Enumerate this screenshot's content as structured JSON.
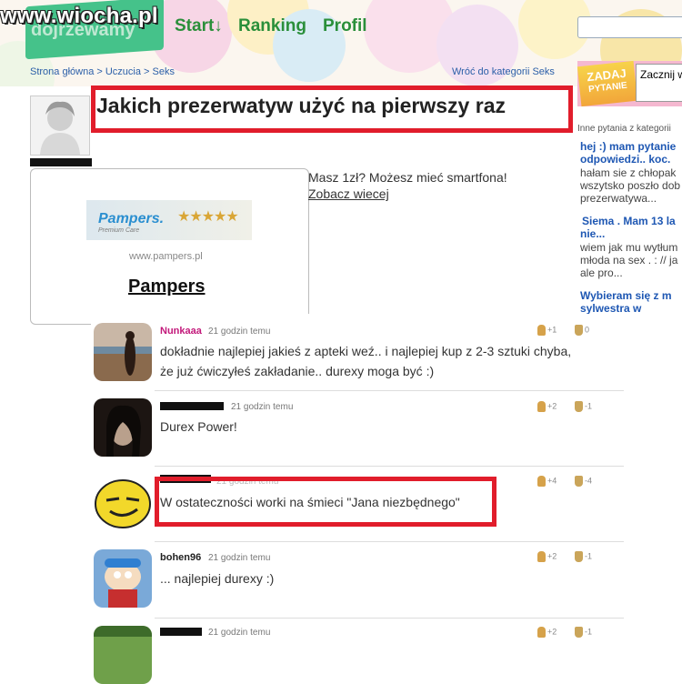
{
  "header": {
    "watermark": "www.wiocha.pl",
    "site_name": "dojrzewamy",
    "nav": [
      "Start↓",
      "Ranking",
      "Profil"
    ],
    "search_placeholder": ""
  },
  "breadcrumb": "Strona główna > Uczucia > Seks",
  "back_link": "Wróć do kategorii Seks",
  "ask": {
    "badge_line1": "ZADAJ",
    "badge_line2": "PYTANIE",
    "input_placeholder": "Zacznij w"
  },
  "question": {
    "title": "Jakich prezerwatyw użyć na pierwszy raz"
  },
  "ad": {
    "brand": "Pampers.",
    "sub": "Premium Care",
    "stars": "★★★★★",
    "url": "www.pampers.pl",
    "title": "Pampers",
    "text": "Masz 1zł? Możesz mieć smartfona!",
    "more": "Zobacz wiecej"
  },
  "sidebar": {
    "heading": "Inne pytania z kategorii",
    "q1_title_1": "hej :) mam pytanie",
    "q1_title_2": "odpowiedzi.. koc.",
    "q1_text_1": "hałam sie z chłopak",
    "q1_text_2": "wszytsko poszło dob",
    "q1_text_3": "prezerwatywa...",
    "q2_title_1": "Siema . Mam 13 la",
    "q2_title_2": "nie...",
    "q2_text_1": "wiem jak mu wytłum",
    "q2_text_2": "młoda na sex . : // ja",
    "q2_text_3": "ale pro...",
    "q3_title_1": "Wybieram się z m",
    "q3_title_2": "sylwestra w"
  },
  "answers": [
    {
      "user": "Nunkaaa",
      "time": "21 godzin temu",
      "text_1": "dokładnie najlepiej jakieś z apteki weź.. i najlepiej kup z 2-3 sztuki chyba,",
      "text_2": "że już ćwiczyłeś zakładanie.. durexy moga być :)",
      "up": "+1",
      "down": "0"
    },
    {
      "user": "",
      "time": "21 godzin temu",
      "text_1": "Durex Power!",
      "up": "+2",
      "down": "-1"
    },
    {
      "user": "",
      "time": "21 godzin temu",
      "text_1": "W ostateczności worki na śmieci \"Jana niezbędnego\"",
      "up": "+4",
      "down": "-4"
    },
    {
      "user": "bohen96",
      "time": "21 godzin temu",
      "text_1": "... najlepiej durexy :)",
      "up": "+2",
      "down": "-1"
    },
    {
      "user": "",
      "time": "21 godzin temu",
      "text_1": "",
      "up": "+2",
      "down": "-1"
    }
  ],
  "colors": {
    "highlight_red": "#e11d2b",
    "nav_green": "#2a8f3a",
    "link_blue": "#2b5fa8"
  }
}
